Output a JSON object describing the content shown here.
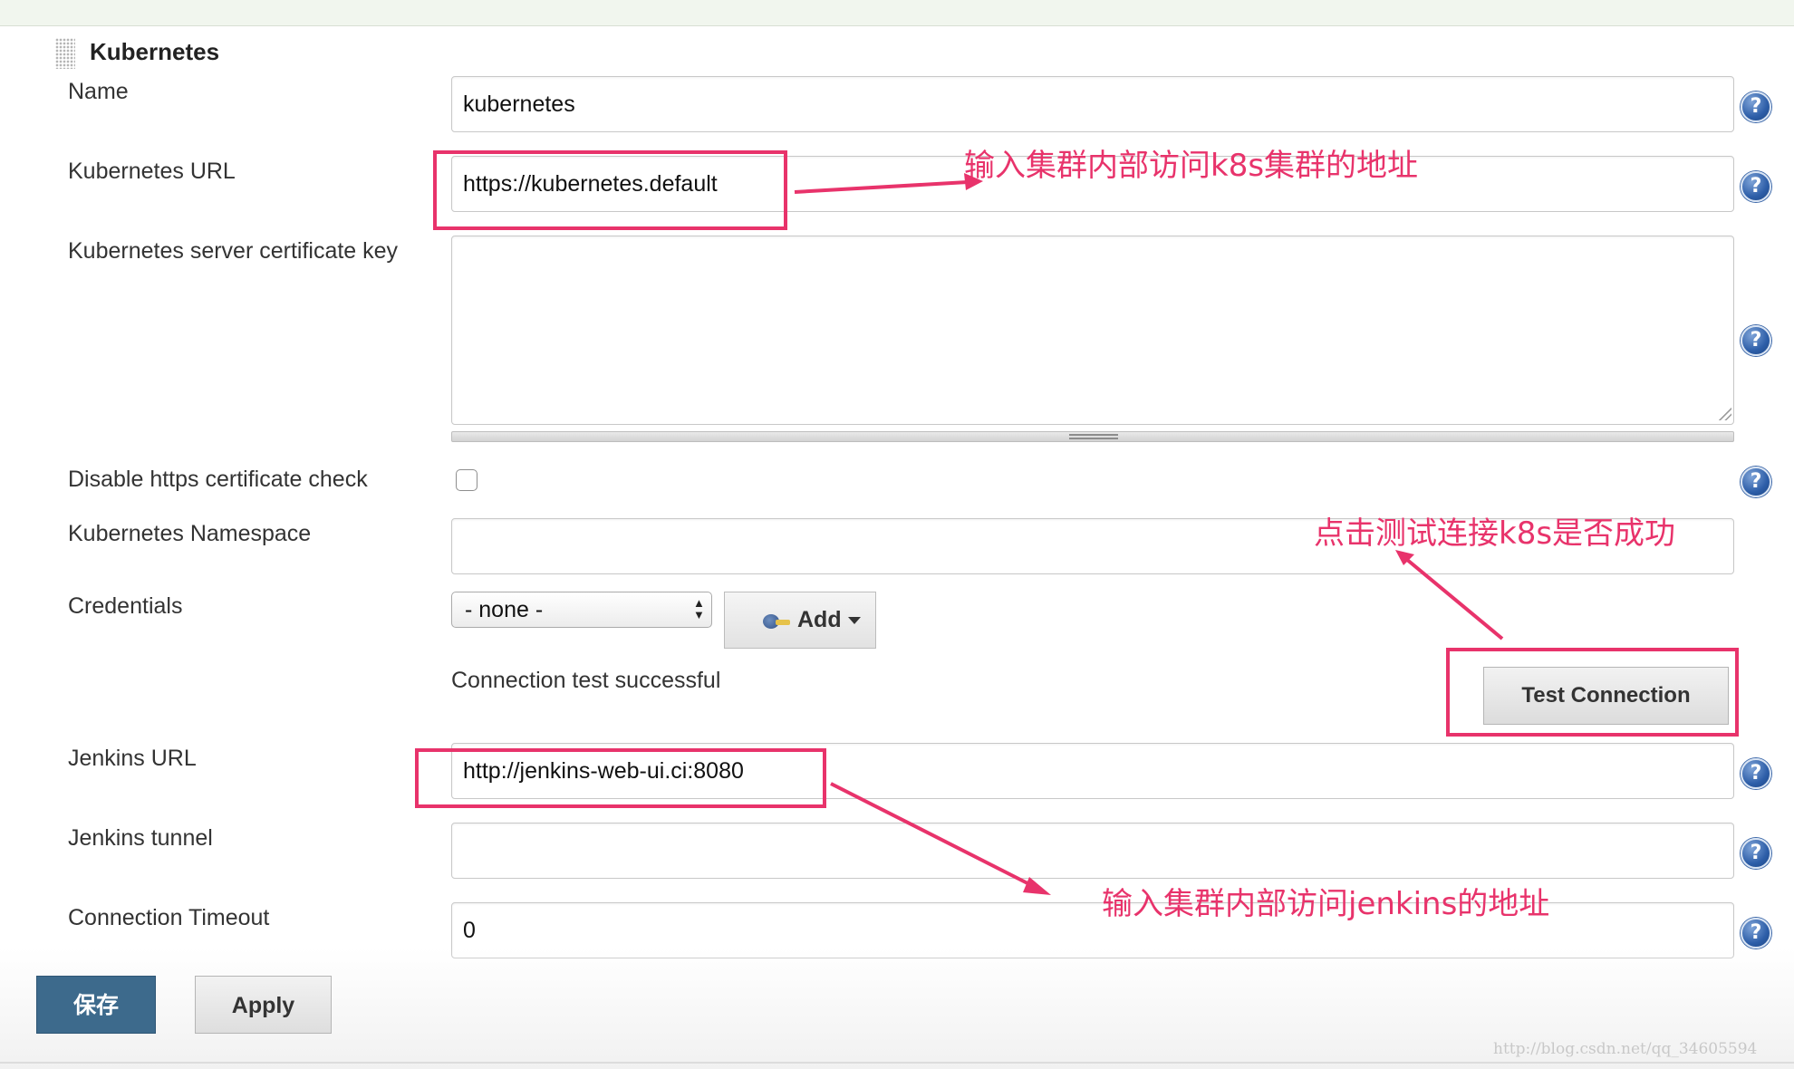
{
  "section": {
    "title": "Kubernetes"
  },
  "fields": {
    "name": {
      "label": "Name",
      "value": "kubernetes"
    },
    "kubernetes_url": {
      "label": "Kubernetes URL",
      "value": "https://kubernetes.default"
    },
    "server_certificate_key": {
      "label": "Kubernetes server certificate key",
      "value": ""
    },
    "disable_https_check": {
      "label": "Disable https certificate check",
      "checked": false
    },
    "namespace": {
      "label": "Kubernetes Namespace",
      "value": ""
    },
    "credentials": {
      "label": "Credentials",
      "selected": "- none -",
      "add_label": "Add"
    },
    "jenkins_url": {
      "label": "Jenkins URL",
      "value": "http://jenkins-web-ui.ci:8080"
    },
    "jenkins_tunnel": {
      "label": "Jenkins tunnel",
      "value": ""
    },
    "connection_timeout": {
      "label": "Connection Timeout",
      "value": "0"
    }
  },
  "connection_test": {
    "status": "Connection test successful",
    "button_label": "Test Connection"
  },
  "help_icon": {
    "glyph": "?",
    "icon": "help-icon"
  },
  "footer": {
    "save_label": "保存",
    "apply_label": "Apply"
  },
  "annotations": {
    "k8s_url_note": "输入集群内部访问k8s集群的地址",
    "test_note": "点击测试连接k8s是否成功",
    "jenkins_url_note": "输入集群内部访问jenkins的地址",
    "color": "#e8336b"
  },
  "watermark": "http://blog.csdn.net/qq_34605594"
}
